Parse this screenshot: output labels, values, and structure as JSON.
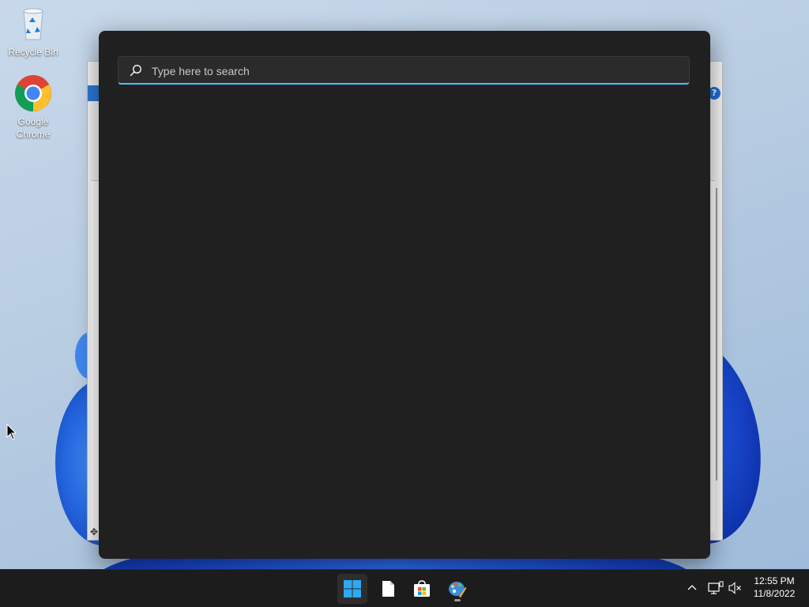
{
  "desktop": {
    "icons": [
      {
        "label": "Recycle Bin",
        "icon": "recycle-bin-icon"
      },
      {
        "label": "Google\nChrome",
        "icon": "chrome-icon"
      }
    ]
  },
  "search": {
    "placeholder": "Type here to search",
    "value": "",
    "icon": "search-icon",
    "accent_color": "#4cc2ff"
  },
  "taskbar": {
    "apps": [
      {
        "name": "Start",
        "icon": "windows-start-icon"
      },
      {
        "name": "File",
        "icon": "file-icon"
      },
      {
        "name": "Microsoft Store",
        "icon": "store-icon"
      },
      {
        "name": "Paint",
        "icon": "paint-icon",
        "running": true
      }
    ],
    "tray": {
      "icons": [
        "chevron-up-icon",
        "network-icon",
        "volume-muted-icon"
      ]
    },
    "clock": {
      "time": "12:55 PM",
      "date": "11/8/2022"
    }
  }
}
